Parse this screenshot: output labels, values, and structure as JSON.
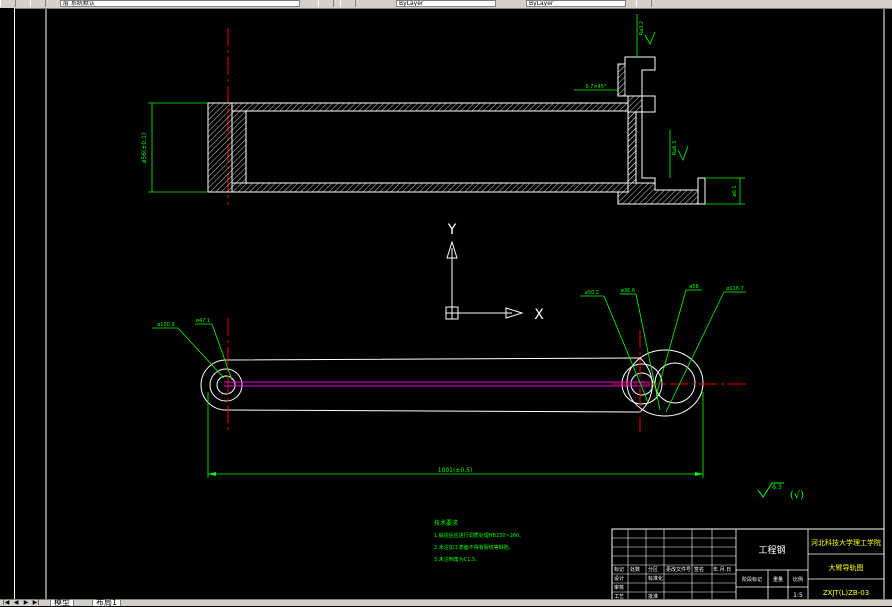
{
  "toolbar": {
    "layer_combo": "层 系统默认",
    "linetype_combo": "ByLayer",
    "lineweight_combo": "ByLayer"
  },
  "tabs": {
    "model": "模型",
    "layout1": "布局1"
  },
  "drawing": {
    "dim_height_left": "ø56(±0.1)",
    "dim_surface1": "Ra3.2",
    "dim_chamfer": "0.7×45°",
    "dim_surface2": "Ra6.3",
    "dim_slot": "ø0.1",
    "dim_d100": "ø100.9",
    "dim_d47": "ø47.1",
    "dim_d50": "ø50.2",
    "dim_d36": "ø36.6",
    "dim_d58": "ø58",
    "dim_d116": "ø116.7",
    "dim_length": "1001(±0.5)",
    "ucs_y": "Y",
    "ucs_x": "X",
    "roughness_mark": "6.3",
    "roughness_paren": "(√)",
    "notes_title": "技术要求",
    "notes": [
      "1.锻造后应进行调质处理HB230~260。",
      "2.未注加工表面不得有裂纹等缺陷。",
      "3.未注倒角为C1.5。"
    ],
    "title_block": {
      "material": "工程钢",
      "school": "河北科技大学理工学院",
      "part_name": "大臂导轨图",
      "drawing_no": "ZXJT(L)ZB-03",
      "scale": "1:5",
      "label_design": "设计",
      "label_check": "审核",
      "label_process": "工艺",
      "label_std": "标准化",
      "label_approve": "批准",
      "label_mark": "标记",
      "label_count": "处数",
      "label_zone": "分区",
      "label_docno": "更改文件号",
      "label_sign": "签名",
      "label_date": "年.月.日",
      "label_stage": "阶段标记",
      "label_weight": "重量",
      "label_ratio": "比例"
    }
  }
}
